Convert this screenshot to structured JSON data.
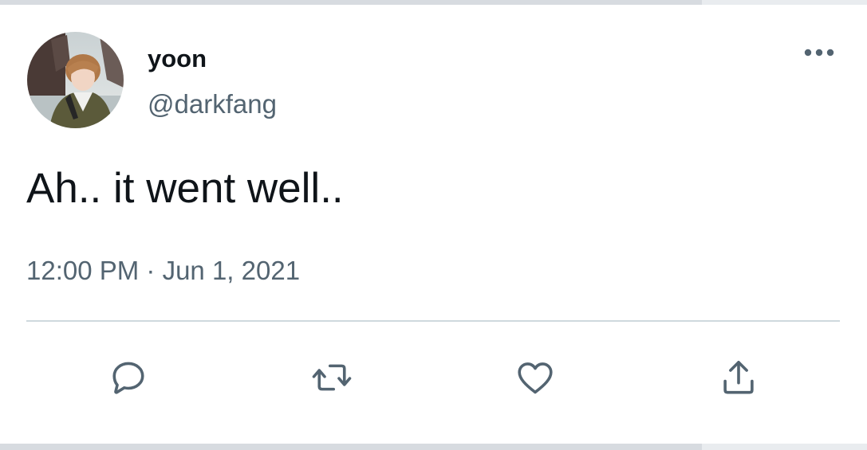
{
  "tweet": {
    "author": {
      "display_name": "yoon",
      "handle": "@darkfang"
    },
    "text": "Ah.. it went well..",
    "timestamp": "12:00 PM · Jun 1, 2021",
    "actions": {
      "reply_icon": "speech-bubble-icon",
      "retweet_icon": "retweet-arrows-icon",
      "like_icon": "heart-icon",
      "share_icon": "share-upload-icon"
    },
    "more_icon": "ellipsis-icon"
  },
  "colors": {
    "text_primary": "#0f1419",
    "text_secondary": "#536471",
    "icon": "#536471",
    "divider": "#cfd9de",
    "card_background": "#ffffff",
    "page_background": "#e9ecef"
  }
}
